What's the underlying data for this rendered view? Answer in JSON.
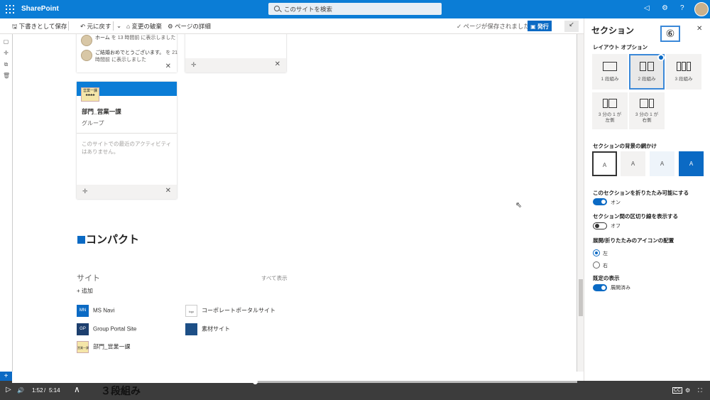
{
  "suitebar": {
    "brand": "SharePoint",
    "search_placeholder": "このサイトを検索"
  },
  "cmdbar": {
    "save_draft": "下書きとして保存",
    "undo": "元に戻す",
    "discard": "変更の破棄",
    "page_details": "ページの詳細",
    "saved_status": "ページが保存されました",
    "publish": "発行"
  },
  "activity": [
    {
      "name": "ホーム",
      "text": "を 13 時間前 に表示しました"
    },
    {
      "name": "ご結婚おめでとうございます。",
      "text": "を 21 時間前 に表示しました"
    }
  ],
  "group_card": {
    "logo_text": "営業一課",
    "title": "部門_営業一課",
    "subtitle": "グループ",
    "empty_text": "このサイトでの最近のアクティビティはありません。"
  },
  "section_heading": "コンパクト",
  "sites": {
    "label": "サイト",
    "show_all": "すべて表示",
    "add": "追加",
    "items": [
      {
        "name": "MS Navi",
        "badge": "MN",
        "color": "#0b6ac4"
      },
      {
        "name": "コーポレートポータルサイト",
        "badge": "logo",
        "color": "#ffffff"
      },
      {
        "name": "Group Portal Site",
        "badge": "GP",
        "color": "#1d3f6e"
      },
      {
        "name": "素材サイト",
        "badge": "",
        "color": "#1d4f86"
      },
      {
        "name": "部門_営業一課",
        "badge": "営業一課",
        "color": "#f5e6a8"
      }
    ]
  },
  "panel": {
    "title": "セクション",
    "layout_label": "レイアウト オプション",
    "layouts": [
      {
        "label": "1 段組み",
        "selected": false
      },
      {
        "label": "2 段組み",
        "selected": true
      },
      {
        "label": "3 段組み",
        "selected": false
      },
      {
        "label": "3 分の 1 が 左側",
        "selected": false
      },
      {
        "label": "3 分の 1 が 右側",
        "selected": false
      }
    ],
    "background_label": "セクションの背景の網かけ",
    "bg_glyph": "A",
    "collapsible_label": "このセクションを折りたたみ可能にする",
    "collapsible_state": "オン",
    "divider_label": "セクション間の区切り線を表示する",
    "divider_state": "オフ",
    "icon_pos_label": "展開/折りたたみのアイコンの配置",
    "icon_pos_left": "左",
    "icon_pos_right": "右",
    "default_label": "既定の表示",
    "default_state": "展開済み"
  },
  "callout": "⑥",
  "video": {
    "current": "1:52",
    "separator": "/",
    "total": "5:14",
    "caption": "３段組み",
    "progress": 0.43
  }
}
